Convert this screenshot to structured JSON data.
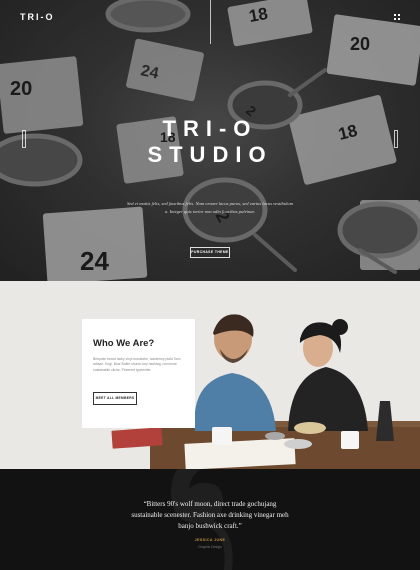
{
  "header": {
    "logo": "TRI-O",
    "menu_icon": "grid-dots-icon"
  },
  "hero": {
    "title_line1": "TRI-O",
    "title_line2": "STUDIO",
    "subtitle": "Sed et mattis felis, sed faucibus felis. Nam ornare lacus purus, sed varius lacus vestibulum a. Integer quis tortor non odio faucibus pulvinar.",
    "cta_label": "PURCHASE THEME",
    "decor_numbers": [
      "18",
      "20",
      "24",
      "2",
      "20",
      "18",
      "18",
      "20",
      "24"
    ]
  },
  "about": {
    "title": "Who We Are?",
    "text": "Bespoke beard tacky vinyl mustache, taxidermy plaid Tonx artisan. Kogi. Blue Bottle church-key hashtag, normcore sustainable cliche, Pinterest typewriter.",
    "cta_label": "MEET ALL MEMBERS"
  },
  "testimonial": {
    "quote": "“Bitters 90's wolf moon, direct trade gochujang sustainable scenester. Fashion axe drinking vinegar meh banjo bushwick craft.”",
    "author": "JESSICA JUNE",
    "role": "Graphic Design"
  },
  "colors": {
    "accent": "#c4933f",
    "dark": "#121212",
    "hero_bg": "#3b3b3b"
  }
}
